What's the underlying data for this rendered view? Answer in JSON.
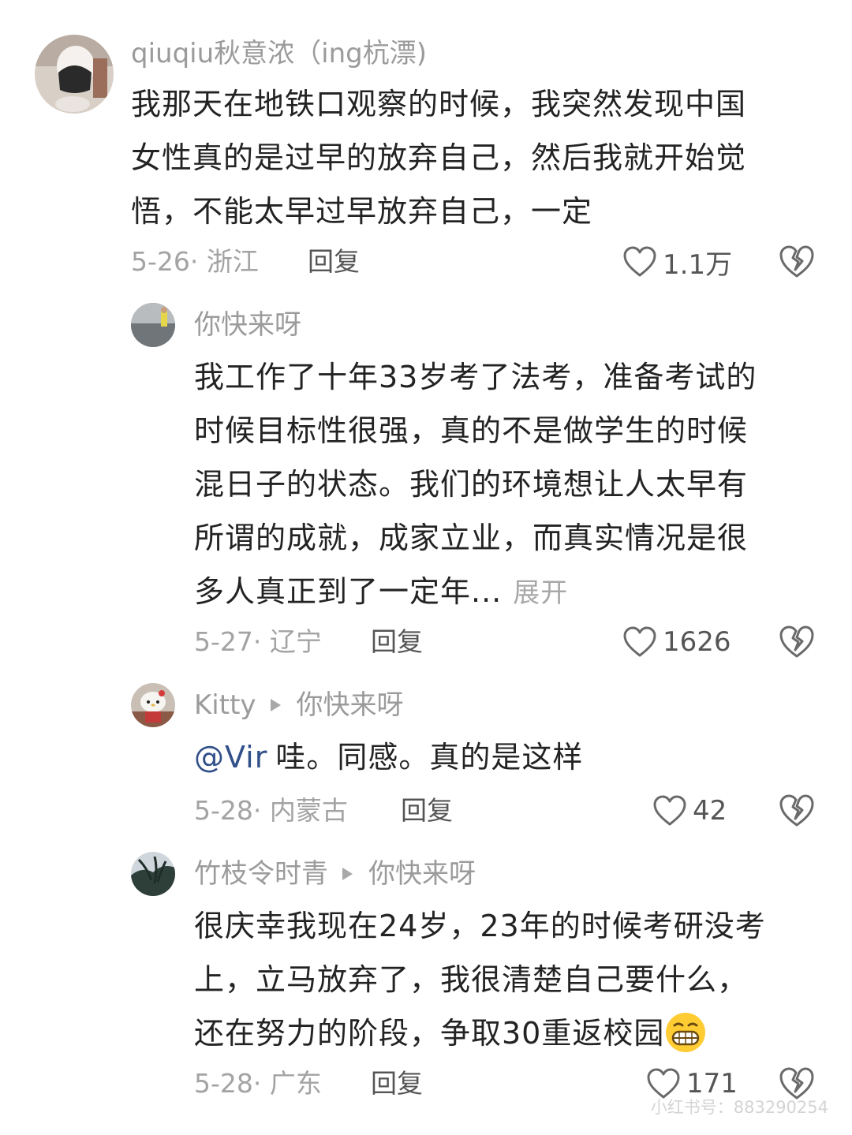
{
  "comments": [
    {
      "author": "qiuqiu秋意浓（ing杭漂)",
      "lines": [
        "我那天在地铁口观察的时候，我突然发现中国",
        "女性真的是过早的放弃自己，然后我就开始觉",
        "悟，不能太早过早放弃自己，一定"
      ],
      "date_loc": "5-26· 浙江",
      "reply_label": "回复",
      "likes": "1.1万"
    },
    {
      "author": "你快来呀",
      "lines": [
        "我工作了十年33岁考了法考，准备考试的",
        "时候目标性很强，真的不是做学生的时候",
        "混日子的状态。我们的环境想让人太早有",
        "所谓的成就，成家立业，而真实情况是很",
        "多人真正到了一定年..."
      ],
      "expand_label": "展开",
      "date_loc": "5-27· 辽宁",
      "reply_label": "回复",
      "likes": "1626"
    },
    {
      "author": "Kitty",
      "reply_to": "你快来呀",
      "mention": "@Vir",
      "text": "哇。同感。真的是这样",
      "date_loc": "5-28· 内蒙古",
      "reply_label": "回复",
      "likes": "42"
    },
    {
      "author": "竹枝令时青",
      "reply_to": "你快来呀",
      "lines": [
        "很庆幸我现在24岁，23年的时候考研没考",
        "上，立马放弃了，我很清楚自己要什么，",
        "还在努力的阶段，争取30重返校园"
      ],
      "date_loc": "5-28· 广东",
      "reply_label": "回复",
      "likes": "171"
    }
  ],
  "watermark": "小红书号：883290254",
  "icons": {
    "like": "heart-icon",
    "dislike": "broken-heart-icon",
    "emoji": "grinning-face-emoji",
    "reply_arrow": "play-triangle-icon"
  }
}
